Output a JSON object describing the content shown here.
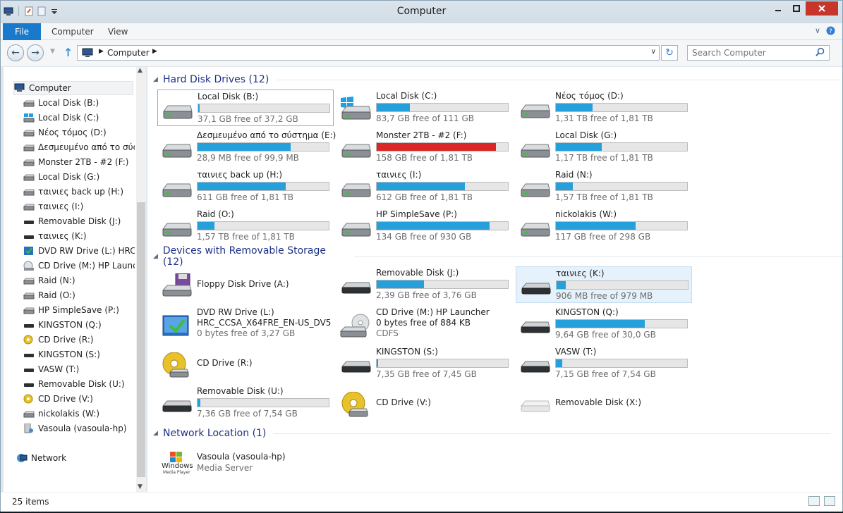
{
  "window": {
    "title": "Computer"
  },
  "ribbon": {
    "tabs": [
      "File",
      "Computer",
      "View"
    ]
  },
  "address": {
    "crumbs": [
      "Computer"
    ]
  },
  "search": {
    "placeholder": "Search Computer"
  },
  "nav_pane": {
    "root": "Computer",
    "items": [
      {
        "label": "Local Disk (B:)",
        "icon": "hdd-icon"
      },
      {
        "label": "Local Disk (C:)",
        "icon": "windows-drive-icon"
      },
      {
        "label": "Νέος τόμος (D:)",
        "icon": "hdd-icon"
      },
      {
        "label": "Δεσμευμένο από το σύστ",
        "icon": "hdd-icon"
      },
      {
        "label": "Monster 2TB - #2 (F:)",
        "icon": "hdd-icon"
      },
      {
        "label": "Local Disk (G:)",
        "icon": "hdd-icon"
      },
      {
        "label": "ταινιες back up (H:)",
        "icon": "hdd-icon"
      },
      {
        "label": "ταινιες (I:)",
        "icon": "hdd-icon"
      },
      {
        "label": "Removable Disk (J:)",
        "icon": "removable-icon"
      },
      {
        "label": "ταινιες (K:)",
        "icon": "removable-icon"
      },
      {
        "label": "DVD RW Drive (L:) HRC_C",
        "icon": "dvd-icon"
      },
      {
        "label": "CD Drive (M:) HP Launche",
        "icon": "cd-icon"
      },
      {
        "label": "Raid (N:)",
        "icon": "hdd-icon"
      },
      {
        "label": "Raid (O:)",
        "icon": "hdd-icon"
      },
      {
        "label": "HP SimpleSave (P:)",
        "icon": "hdd-icon"
      },
      {
        "label": "KINGSTON (Q:)",
        "icon": "removable-icon"
      },
      {
        "label": "CD Drive (R:)",
        "icon": "cd-gold-icon"
      },
      {
        "label": "KINGSTON (S:)",
        "icon": "removable-icon"
      },
      {
        "label": "VASW (T:)",
        "icon": "removable-icon"
      },
      {
        "label": "Removable Disk (U:)",
        "icon": "removable-icon"
      },
      {
        "label": "CD Drive (V:)",
        "icon": "cd-gold-icon"
      },
      {
        "label": "nickolakis (W:)",
        "icon": "hdd-icon"
      },
      {
        "label": "Vasoula (vasoula-hp)",
        "icon": "media-server-icon"
      }
    ],
    "network": "Network"
  },
  "groups": {
    "hdd": "Hard Disk Drives (12)",
    "removable": "Devices with Removable Storage (12)",
    "network": "Network Location (1)"
  },
  "drives": [
    {
      "name": "Local Disk (B:)",
      "free": "37,1 GB free of 37,2 GB",
      "used": 0.003,
      "icon": "hdd-icon",
      "red": false
    },
    {
      "name": "Local Disk (C:)",
      "free": "83,7 GB free of 111 GB",
      "used": 0.25,
      "icon": "windows-drive-icon",
      "red": false
    },
    {
      "name": "Νέος τόμος (D:)",
      "free": "1,31 TB free of 1,81 TB",
      "used": 0.28,
      "icon": "hdd-icon",
      "red": false
    },
    {
      "name": "Δεσμευμένο από το σύστημα (E:)",
      "free": "28,9 MB free of 99,9 MB",
      "used": 0.71,
      "icon": "hdd-icon",
      "red": false
    },
    {
      "name": "Monster 2TB - #2 (F:)",
      "free": "158 GB free of 1,81 TB",
      "used": 0.91,
      "icon": "hdd-icon",
      "red": true
    },
    {
      "name": "Local Disk (G:)",
      "free": "1,17 TB free of 1,81 TB",
      "used": 0.35,
      "icon": "hdd-icon",
      "red": false
    },
    {
      "name": "ταινιες back up (H:)",
      "free": "611 GB free of 1,81 TB",
      "used": 0.67,
      "icon": "hdd-icon",
      "red": false
    },
    {
      "name": "ταινιες (I:)",
      "free": "612 GB free of 1,81 TB",
      "used": 0.67,
      "icon": "hdd-icon",
      "red": false
    },
    {
      "name": "Raid (N:)",
      "free": "1,57 TB free of 1,81 TB",
      "used": 0.13,
      "icon": "hdd-icon",
      "red": false
    },
    {
      "name": "Raid (O:)",
      "free": "1,57 TB free of 1,81 TB",
      "used": 0.13,
      "icon": "hdd-icon",
      "red": false
    },
    {
      "name": "HP SimpleSave (P:)",
      "free": "134 GB free of 930 GB",
      "used": 0.86,
      "icon": "hdd-icon",
      "red": false
    },
    {
      "name": "nickolakis (W:)",
      "free": "117 GB free of 298 GB",
      "used": 0.61,
      "icon": "hdd-icon",
      "red": false
    }
  ],
  "removable": [
    {
      "kind": "name-only",
      "name": "Floppy Disk Drive (A:)",
      "icon": "floppy-icon"
    },
    {
      "kind": "bar",
      "name": "Removable Disk (J:)",
      "free": "2,39 GB free of 3,76 GB",
      "used": 0.36,
      "icon": "removable-icon"
    },
    {
      "kind": "bar",
      "name": "ταινιες (K:)",
      "free": "906 MB free of 979 MB",
      "used": 0.07,
      "icon": "removable-icon"
    },
    {
      "kind": "three-line",
      "name": "DVD RW Drive (L:)",
      "line2": "HRC_CCSA_X64FRE_EN-US_DV5",
      "line3": "0 bytes free of 3,27 GB",
      "icon": "dvd-icon"
    },
    {
      "kind": "three-line",
      "name": "CD Drive (M:) HP Launcher",
      "line2": "0 bytes free of 884 KB",
      "line3": "CDFS",
      "icon": "cd-icon"
    },
    {
      "kind": "bar",
      "name": "KINGSTON (Q:)",
      "free": "9,64 GB free of 30,0 GB",
      "used": 0.68,
      "icon": "removable-icon"
    },
    {
      "kind": "name-only",
      "name": "CD Drive (R:)",
      "icon": "cd-gold-icon"
    },
    {
      "kind": "bar",
      "name": "KINGSTON (S:)",
      "free": "7,35 GB free of 7,45 GB",
      "used": 0.013,
      "icon": "removable-icon"
    },
    {
      "kind": "bar",
      "name": "VASW (T:)",
      "free": "7,15 GB free of 7,54 GB",
      "used": 0.05,
      "icon": "removable-icon"
    },
    {
      "kind": "bar",
      "name": "Removable Disk (U:)",
      "free": "7,36 GB free of 7,54 GB",
      "used": 0.02,
      "icon": "removable-icon"
    },
    {
      "kind": "name-only",
      "name": "CD Drive (V:)",
      "icon": "cd-gold-icon"
    },
    {
      "kind": "name-only",
      "name": "Removable Disk (X:)",
      "icon": "removable-white-icon"
    }
  ],
  "network_items": [
    {
      "name": "Vasoula (vasoula-hp)",
      "sub": "Media Server",
      "logo_text": "Windows",
      "logo_sub": "Media Player",
      "icon": "media-server-icon"
    }
  ],
  "status": {
    "count": "25 items"
  },
  "colors": {
    "bar": "#26a0da",
    "bar_full": "#da2626",
    "group_title": "#1e3287",
    "file_tab": "#1979ca"
  }
}
